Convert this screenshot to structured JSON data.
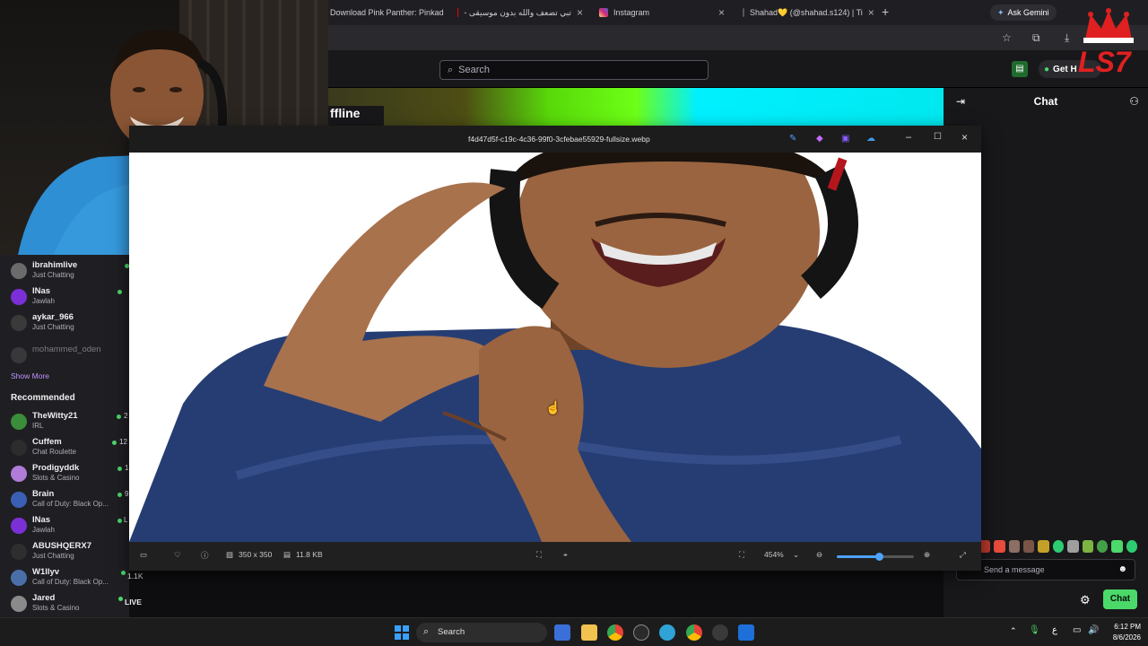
{
  "browser": {
    "tabs": [
      {
        "title": "Download Pink Panther: Pinkad",
        "favicon_color": "#e04040"
      },
      {
        "title": "تبي تضعف والله بدون موسيقى -",
        "favicon_color": "#ff0000"
      },
      {
        "title": "Instagram",
        "favicon_color": "#d6249f"
      },
      {
        "title": "Shahad💛 (@shahad.s124) | Ti",
        "favicon_color": "#ffffff"
      }
    ],
    "ask_gemini": "Ask Gemini"
  },
  "twitch": {
    "search_placeholder": "Search",
    "get_help": "Get H",
    "offline_text": "ffline",
    "chat_title": "Chat",
    "chat_input_placeholder": "Send a message",
    "chat_button": "Chat"
  },
  "sidebar": {
    "followed": [
      {
        "name": "ibrahimlive",
        "category": "Just Chatting",
        "avatar": "#6b6b6b"
      },
      {
        "name": "INas",
        "category": "Jawlah",
        "avatar": "#7b2fd6"
      },
      {
        "name": "aykar_966",
        "category": "Just Chatting",
        "avatar": "#3a3a3a"
      },
      {
        "name": "mohammed_oden",
        "category": "",
        "avatar": "#4a4a4a"
      }
    ],
    "show_more": "Show More",
    "recommended_heading": "Recommended",
    "recommended": [
      {
        "name": "TheWitty21",
        "category": "IRL",
        "viewers": "2",
        "avatar": "#3a8d3a"
      },
      {
        "name": "Cuffem",
        "category": "Chat Roulette",
        "viewers": "12",
        "avatar": "#2c2c2c"
      },
      {
        "name": "Prodigyddk",
        "category": "Slots & Casino",
        "viewers": "1",
        "avatar": "#b07bd9"
      },
      {
        "name": "Brain",
        "category": "Call of Duty: Black Op...",
        "viewers": "9",
        "avatar": "#3b5fb5"
      },
      {
        "name": "INas",
        "category": "Jawlah",
        "viewers": "L",
        "avatar": "#7b2fd6"
      },
      {
        "name": "ABUSHQERX7",
        "category": "Just Chatting",
        "viewers": "",
        "avatar": "#2e2e2e"
      },
      {
        "name": "W1llyv",
        "category": "Call of Duty: Black Op...",
        "viewers": "1.1K",
        "avatar": "#4a6ea8"
      },
      {
        "name": "Jared",
        "category": "Slots & Casino",
        "viewers": "LIVE",
        "avatar": "#8a8a8a"
      }
    ]
  },
  "viewer": {
    "filename": "f4d47d5f-c19c-4c36-99f0-3cfebae55929-fullsize.webp",
    "dimensions": "350 x 350",
    "file_size": "11.8 KB",
    "zoom": "454%",
    "zoom_slider_fraction": 0.55
  },
  "taskbar": {
    "search": "Search",
    "time": "6:12 PM",
    "date": "8/6/2026",
    "input_indicator": "ع"
  },
  "watermark": "LS7"
}
